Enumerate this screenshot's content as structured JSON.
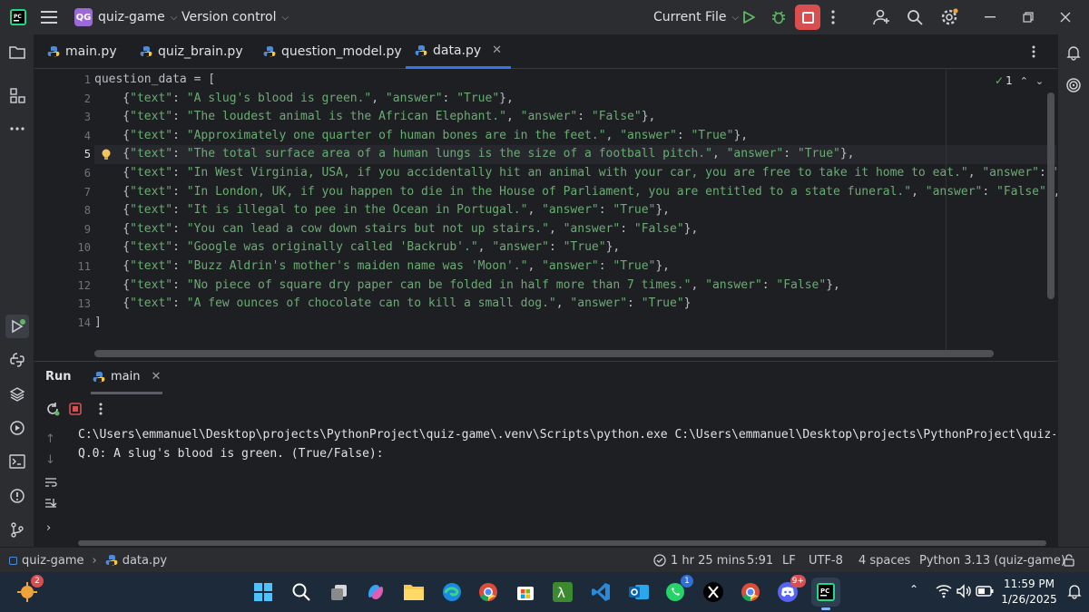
{
  "titlebar": {
    "project_badge": "QG",
    "project_name": "quiz-game",
    "vcs_label": "Version control",
    "run_config": "Current File"
  },
  "tabs": [
    {
      "label": "main.py",
      "active": false
    },
    {
      "label": "quiz_brain.py",
      "active": false
    },
    {
      "label": "question_model.py",
      "active": false
    },
    {
      "label": "data.py",
      "active": true
    }
  ],
  "editor": {
    "line_numbers": [
      "1",
      "2",
      "3",
      "4",
      "5",
      "6",
      "7",
      "8",
      "9",
      "10",
      "11",
      "12",
      "13",
      "14"
    ],
    "current_line": 5,
    "inspection_count": "1",
    "lines": [
      "question_data = [",
      "    {\"text\": \"A slug's blood is green.\", \"answer\": \"True\"},",
      "    {\"text\": \"The loudest animal is the African Elephant.\", \"answer\": \"False\"},",
      "    {\"text\": \"Approximately one quarter of human bones are in the feet.\", \"answer\": \"True\"},",
      "    {\"text\": \"The total surface area of a human lungs is the size of a football pitch.\", \"answer\": \"True\"},",
      "    {\"text\": \"In West Virginia, USA, if you accidentally hit an animal with your car, you are free to take it home to eat.\", \"answer\": \"True\"",
      "    {\"text\": \"In London, UK, if you happen to die in the House of Parliament, you are entitled to a state funeral.\", \"answer\": \"False\"},",
      "    {\"text\": \"It is illegal to pee in the Ocean in Portugal.\", \"answer\": \"True\"},",
      "    {\"text\": \"You can lead a cow down stairs but not up stairs.\", \"answer\": \"False\"},",
      "    {\"text\": \"Google was originally called 'Backrub'.\", \"answer\": \"True\"},",
      "    {\"text\": \"Buzz Aldrin's mother's maiden name was 'Moon'.\", \"answer\": \"True\"},",
      "    {\"text\": \"No piece of square dry paper can be folded in half more than 7 times.\", \"answer\": \"False\"},",
      "    {\"text\": \"A few ounces of chocolate can to kill a small dog.\", \"answer\": \"True\"}",
      "]"
    ]
  },
  "run": {
    "title": "Run",
    "tab_label": "main",
    "console": [
      "C:\\Users\\emmanuel\\Desktop\\projects\\PythonProject\\quiz-game\\.venv\\Scripts\\python.exe C:\\Users\\emmanuel\\Desktop\\projects\\PythonProject\\quiz-game\\m",
      "Q.0: A slug's blood is green. (True/False):"
    ]
  },
  "statusbar": {
    "project": "quiz-game",
    "file": "data.py",
    "time": "1 hr 25 mins",
    "position": "5:91",
    "line_sep": "LF",
    "encoding": "UTF-8",
    "indent": "4 spaces",
    "interpreter": "Python 3.13 (quiz-game)"
  },
  "taskbar": {
    "weather_badge": "2",
    "whatsapp_badge": "1",
    "discord_badge": "9+",
    "time": "11:59 PM",
    "date": "1/26/2025"
  },
  "colors": {
    "accent": "#3574f0",
    "string": "#6aab73",
    "stop": "#d94f50",
    "run": "#5fb865"
  }
}
